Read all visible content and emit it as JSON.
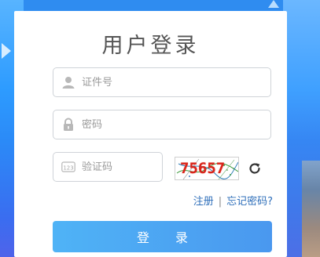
{
  "login": {
    "title": "用户登录",
    "username": {
      "placeholder": "证件号",
      "value": "",
      "icon": "user-icon"
    },
    "password": {
      "placeholder": "密码",
      "value": "",
      "icon": "lock-icon"
    },
    "captcha_input": {
      "placeholder": "验证码",
      "value": "",
      "icon": "keypad-icon"
    },
    "captcha_image": {
      "text": "75657"
    },
    "refresh_icon": "refresh-icon",
    "register_link": "注册",
    "separator": "|",
    "forgot_link": "忘记密码?",
    "submit_label": "登 录"
  },
  "colors": {
    "accent": "#4a9df1",
    "link": "#2f6fba",
    "captcha_text": "#d9241a",
    "background": "#2f8cf0"
  }
}
